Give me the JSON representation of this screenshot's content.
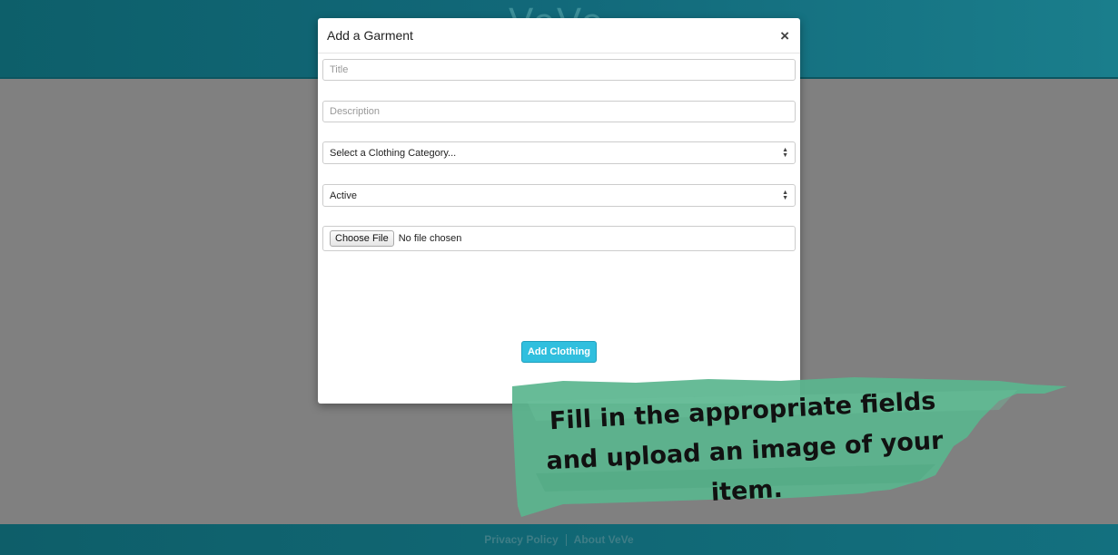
{
  "app": {
    "logo": "VeVe",
    "colors": {
      "header": "#12697a",
      "accent": "#30bfde",
      "annotation": "#5ab58e"
    }
  },
  "modal": {
    "title": "Add a Garment",
    "close_label": "×",
    "fields": {
      "title_placeholder": "Title",
      "description_placeholder": "Description",
      "category_selected": "Select a Clothing Category...",
      "status_selected": "Active",
      "file_button_label": "Choose File",
      "file_status": "No file chosen"
    },
    "submit_label": "Add Clothing"
  },
  "footer": {
    "links": [
      "Privacy Policy",
      "About VeVe"
    ]
  },
  "annotation": {
    "text": "Fill in the appropriate fields and upload an image of your item."
  }
}
